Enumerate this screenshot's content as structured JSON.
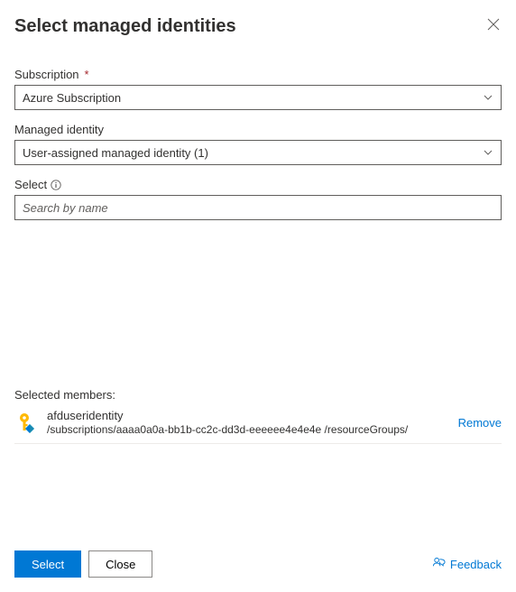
{
  "header": {
    "title": "Select managed identities"
  },
  "fields": {
    "subscription": {
      "label": "Subscription",
      "value": "Azure Subscription"
    },
    "managedIdentity": {
      "label": "Managed identity",
      "value": "User-assigned managed identity (1)"
    },
    "select": {
      "label": "Select",
      "placeholder": "Search by name",
      "value": ""
    }
  },
  "selected": {
    "label": "Selected members:",
    "members": [
      {
        "name": "afduseridentity",
        "path": "/subscriptions/aaaa0a0a-bb1b-cc2c-dd3d-eeeeee4e4e4e /resourceGroups/",
        "removeLabel": "Remove"
      }
    ]
  },
  "footer": {
    "select": "Select",
    "close": "Close",
    "feedback": "Feedback"
  }
}
